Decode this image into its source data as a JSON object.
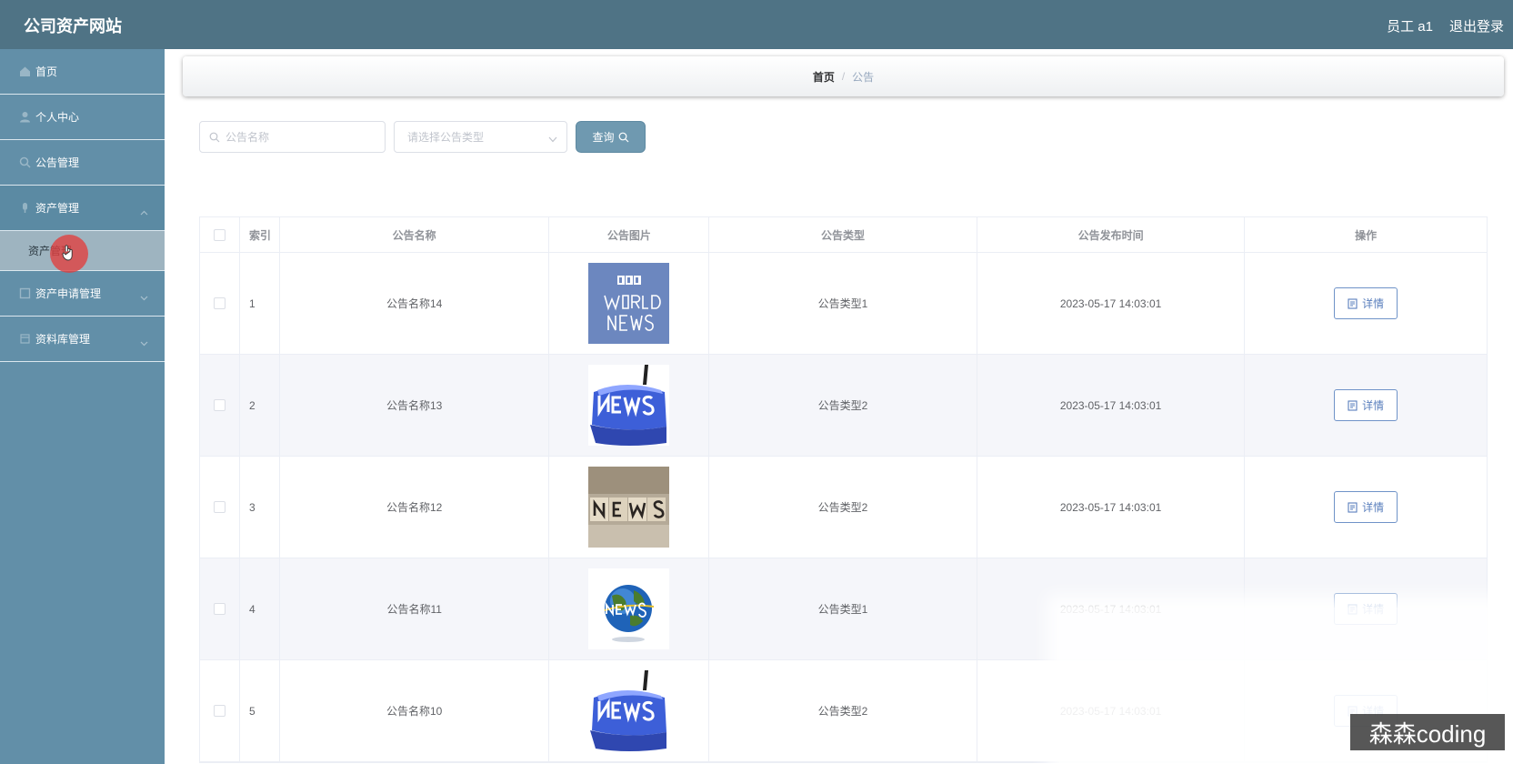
{
  "header": {
    "brand": "公司资产网站",
    "user_label": "员工 a1",
    "logout_label": "退出登录"
  },
  "sidebar": {
    "items": [
      {
        "label": "首页",
        "icon": "home-icon"
      },
      {
        "label": "个人中心",
        "icon": "user-icon"
      },
      {
        "label": "公告管理",
        "icon": "notice-icon"
      },
      {
        "label": "资产管理",
        "icon": "asset-icon",
        "expanded": true
      },
      {
        "label": "资产申请管理",
        "icon": "apply-icon"
      },
      {
        "label": "资料库管理",
        "icon": "library-icon"
      }
    ],
    "submenu_item": "资产管理"
  },
  "breadcrumb": {
    "home": "首页",
    "separator": "/",
    "current": "公告"
  },
  "search": {
    "name_placeholder": "公告名称",
    "type_placeholder": "请选择公告类型",
    "query_label": "查询"
  },
  "table": {
    "columns": [
      "索引",
      "公告名称",
      "公告图片",
      "公告类型",
      "公告发布时间",
      "操作"
    ],
    "rows": [
      {
        "index": "1",
        "name": "公告名称14",
        "image": "bbc-world-news-image",
        "type": "公告类型1",
        "time": "2023-05-17 14:03:01",
        "action": "详情"
      },
      {
        "index": "2",
        "name": "公告名称13",
        "image": "news-key-image",
        "type": "公告类型2",
        "time": "2023-05-17 14:03:01",
        "action": "详情"
      },
      {
        "index": "3",
        "name": "公告名称12",
        "image": "news-blocks-image",
        "type": "公告类型2",
        "time": "2023-05-17 14:03:01",
        "action": "详情"
      },
      {
        "index": "4",
        "name": "公告名称11",
        "image": "news-globe-image",
        "type": "公告类型1",
        "time": "2023-05-17 14:03:01",
        "action": "详情"
      },
      {
        "index": "5",
        "name": "公告名称10",
        "image": "news-key-image",
        "type": "公告类型2",
        "time": "2023-05-17 14:03:01",
        "action": "详情"
      }
    ]
  },
  "watermark": "森森coding",
  "colors": {
    "topbar": "#4f7385",
    "sidebar": "#628fa8",
    "query_button": "#6f99b0",
    "detail_border": "#6f93c8"
  }
}
